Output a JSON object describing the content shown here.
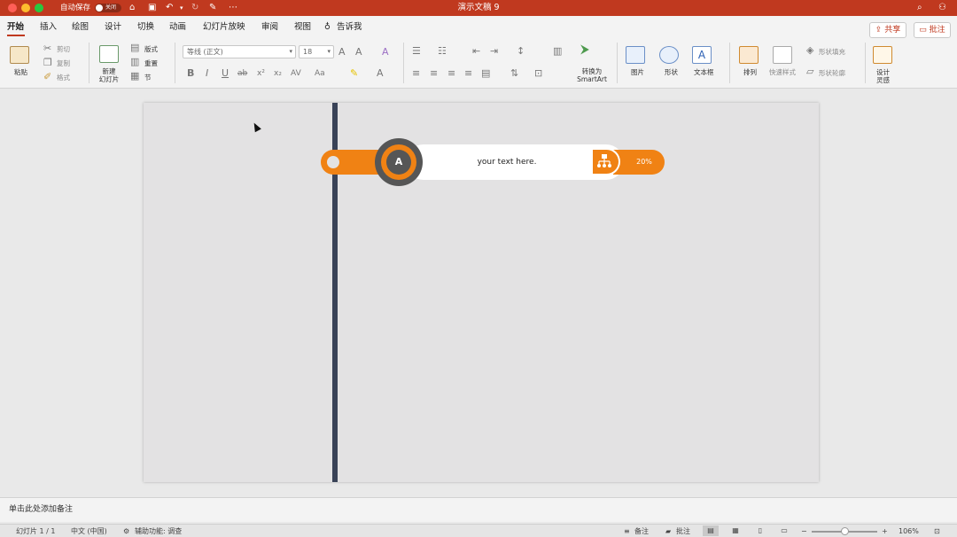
{
  "titlebar": {
    "autosave_label": "自动保存",
    "autosave_state": "关闭",
    "doc_title": "演示文稿 9",
    "quick_icons": [
      "home-icon",
      "save-icon",
      "undo-icon",
      "redo-icon",
      "edit-icon",
      "more-icon"
    ]
  },
  "tabs": [
    "开始",
    "插入",
    "绘图",
    "设计",
    "切换",
    "动画",
    "幻灯片放映",
    "审阅",
    "视图"
  ],
  "tellme": "告诉我",
  "share_label": "共享",
  "comment_label": "批注",
  "ribbon": {
    "paste": "粘贴",
    "cut": "剪切",
    "copy": "复制",
    "format": "格式",
    "new_slide_1": "新建",
    "new_slide_2": "幻灯片",
    "layout": "版式",
    "reset": "重置",
    "section": "节",
    "font_name": "等线 (正文)",
    "font_size": "18",
    "smartart_1": "转换为",
    "smartart_2": "SmartArt",
    "picture": "图片",
    "shapes": "形状",
    "textbox": "文本框",
    "arrange": "排列",
    "quick_styles": "快速样式",
    "shape_fill": "形状填充",
    "shape_outline": "形状轮廓",
    "design_1": "设计",
    "design_2": "灵感",
    "format_buttons": [
      "B",
      "I",
      "U",
      "ab",
      "x²",
      "x₂",
      "AV",
      "Aa",
      "A"
    ]
  },
  "slide": {
    "badge_letter": "A",
    "body_text": "your text here.",
    "percent": "20%",
    "colors": {
      "accent": "#f08214",
      "ring": "#565656",
      "line": "#394257"
    }
  },
  "notes_placeholder": "单击此处添加备注",
  "status": {
    "slide_info": "幻灯片 1 / 1",
    "language": "中文 (中国)",
    "accessibility": "辅助功能: 调查",
    "notes": "备注",
    "comments": "批注",
    "zoom": "106%"
  }
}
